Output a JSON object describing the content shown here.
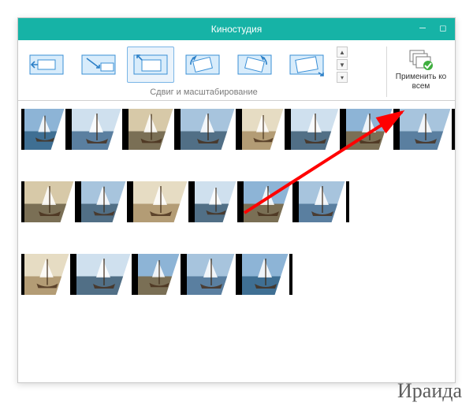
{
  "window": {
    "title": "Киностудия"
  },
  "ribbon": {
    "group_label": "Сдвиг и масштабирование",
    "apply_all": "Применить ко всем",
    "transitions": [
      {
        "name": "pan-right",
        "arrow": "right"
      },
      {
        "name": "pan-down-right",
        "arrow": "dr"
      },
      {
        "name": "zoom-in",
        "arrow": "in"
      },
      {
        "name": "rotate-left",
        "arrow": "rl"
      },
      {
        "name": "rotate-right",
        "arrow": "rr"
      },
      {
        "name": "zoom-tilt",
        "arrow": "tilt"
      }
    ]
  },
  "timeline_rows": [
    {
      "clips": 8
    },
    {
      "clips": 6
    },
    {
      "clips": 5
    }
  ],
  "palette": {
    "sky1": "#8db4d6",
    "sea1": "#3f6f93",
    "sky2": "#cfe0ee",
    "sea2": "#5a7fa0",
    "sky3": "#d7c9a8",
    "sea3": "#7a6f55",
    "sky4": "#a7c4dd",
    "sea4": "#516f86",
    "sky5": "#e6dcc3",
    "sea5": "#b39c75"
  },
  "signature": "Ираида"
}
